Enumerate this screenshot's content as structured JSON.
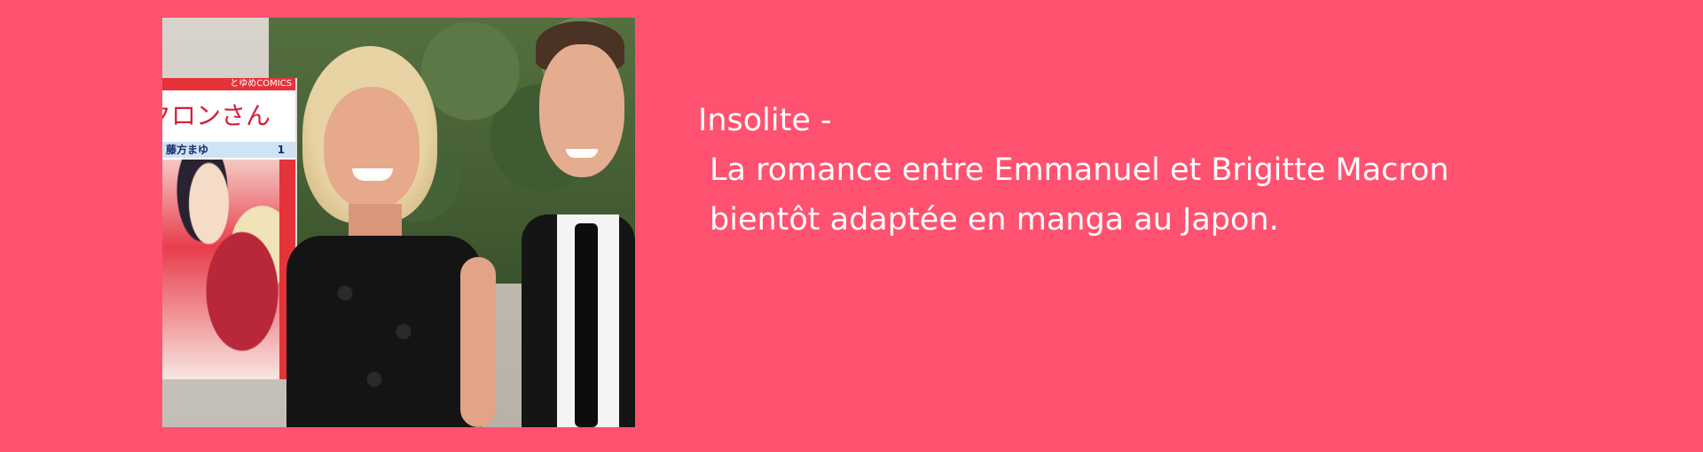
{
  "colors": {
    "background": "#ff5270",
    "text": "#ffffff",
    "manga_red": "#e4343a"
  },
  "photo": {
    "manga_cover": {
      "publisher_label": "とゆめCOMICS",
      "title": "クロンさん",
      "author": "藤方まゆ",
      "volume": "1"
    }
  },
  "headline": {
    "category": "Insolite -",
    "line1": "La romance entre Emmanuel et Brigitte Macron",
    "line2": "bientôt adaptée en manga au Japon."
  }
}
